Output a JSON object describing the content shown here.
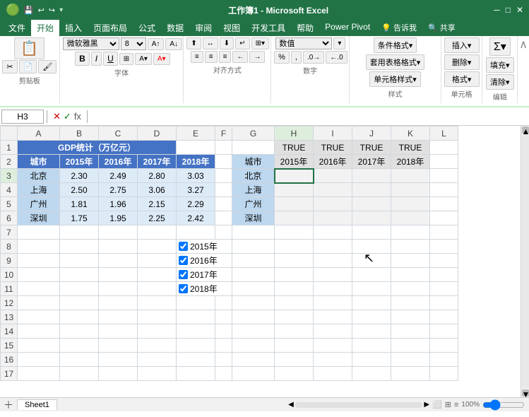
{
  "titleBar": {
    "title": "工作簿1 - Microsoft Excel",
    "minimize": "─",
    "maximize": "□",
    "close": "✕",
    "quickAccess": [
      "💾",
      "↩",
      "↪"
    ]
  },
  "ribbonTabs": [
    "文件",
    "开始",
    "插入",
    "页面布局",
    "公式",
    "数据",
    "审阅",
    "视图",
    "开发工具",
    "帮助",
    "Power Pivot",
    "💡 告诉我",
    "🔍 共享"
  ],
  "activeTab": "开始",
  "toolbar": {
    "clipboard": "剪贴板",
    "font": "字体",
    "alignment": "对齐方式",
    "number": "数字",
    "styles": "样式",
    "cells": "单元格",
    "editing": "编辑",
    "fontName": "微软雅黑",
    "fontSize": "8",
    "bold": "B",
    "italic": "I",
    "underline": "U",
    "conditionalFormat": "条件格式▾",
    "tableFormat": "套用表格格式▾",
    "cellStyle": "单元格样式▾",
    "insert": "单元格",
    "editBtn": "编辑"
  },
  "formulaBar": {
    "cellRef": "H3",
    "formula": ""
  },
  "columns": {
    "widths": [
      24,
      60,
      55,
      55,
      55,
      55,
      24,
      60,
      55,
      55,
      55,
      55,
      40
    ],
    "labels": [
      "",
      "A",
      "B",
      "C",
      "D",
      "E",
      "F",
      "G",
      "H",
      "I",
      "J",
      "K",
      "L"
    ]
  },
  "rows": [
    {
      "num": 1,
      "cells": [
        {
          "text": "",
          "class": ""
        },
        {
          "text": "GDP统计（万亿元）",
          "class": "data-cell-blue",
          "colspan": 4
        },
        {
          "text": "",
          "class": ""
        },
        {
          "text": "",
          "class": ""
        },
        {
          "text": "",
          "class": ""
        },
        {
          "text": "TRUE",
          "class": "true-cell"
        },
        {
          "text": "TRUE",
          "class": "true-cell"
        },
        {
          "text": "TRUE",
          "class": "true-cell"
        },
        {
          "text": "TRUE",
          "class": "true-cell"
        },
        {
          "text": "",
          "class": ""
        }
      ]
    },
    {
      "num": 2,
      "cells": [
        {
          "text": "",
          "class": ""
        },
        {
          "text": "城市",
          "class": "data-cell-header"
        },
        {
          "text": "2015年",
          "class": "data-cell-header"
        },
        {
          "text": "2016年",
          "class": "data-cell-header"
        },
        {
          "text": "2017年",
          "class": "data-cell-header"
        },
        {
          "text": "2018年",
          "class": "data-cell-header"
        },
        {
          "text": "",
          "class": ""
        },
        {
          "text": "城市",
          "class": "data-cell-city"
        },
        {
          "text": "2015年",
          "class": "data-cell-gray"
        },
        {
          "text": "2016年",
          "class": "data-cell-gray"
        },
        {
          "text": "2017年",
          "class": "data-cell-gray"
        },
        {
          "text": "2018年",
          "class": "data-cell-gray"
        },
        {
          "text": "",
          "class": ""
        }
      ]
    },
    {
      "num": 3,
      "cells": [
        {
          "text": "",
          "class": ""
        },
        {
          "text": "北京",
          "class": "data-cell-city"
        },
        {
          "text": "2.30",
          "class": "data-cell-value"
        },
        {
          "text": "2.49",
          "class": "data-cell-value"
        },
        {
          "text": "2.80",
          "class": "data-cell-value"
        },
        {
          "text": "3.03",
          "class": "data-cell-value"
        },
        {
          "text": "",
          "class": ""
        },
        {
          "text": "北京",
          "class": "data-cell-city"
        },
        {
          "text": "",
          "class": "data-cell-lightgray"
        },
        {
          "text": "",
          "class": "data-cell-lightgray"
        },
        {
          "text": "",
          "class": "data-cell-lightgray"
        },
        {
          "text": "",
          "class": "data-cell-lightgray"
        },
        {
          "text": "",
          "class": ""
        }
      ]
    },
    {
      "num": 4,
      "cells": [
        {
          "text": "",
          "class": ""
        },
        {
          "text": "上海",
          "class": "data-cell-city"
        },
        {
          "text": "2.50",
          "class": "data-cell-value"
        },
        {
          "text": "2.75",
          "class": "data-cell-value"
        },
        {
          "text": "3.06",
          "class": "data-cell-value"
        },
        {
          "text": "3.27",
          "class": "data-cell-value"
        },
        {
          "text": "",
          "class": ""
        },
        {
          "text": "上海",
          "class": "data-cell-city"
        },
        {
          "text": "",
          "class": "data-cell-lightgray"
        },
        {
          "text": "",
          "class": "data-cell-lightgray"
        },
        {
          "text": "",
          "class": "data-cell-lightgray"
        },
        {
          "text": "",
          "class": "data-cell-lightgray"
        },
        {
          "text": "",
          "class": ""
        }
      ]
    },
    {
      "num": 5,
      "cells": [
        {
          "text": "",
          "class": ""
        },
        {
          "text": "广州",
          "class": "data-cell-city"
        },
        {
          "text": "1.81",
          "class": "data-cell-value"
        },
        {
          "text": "1.96",
          "class": "data-cell-value"
        },
        {
          "text": "2.15",
          "class": "data-cell-value"
        },
        {
          "text": "2.29",
          "class": "data-cell-value"
        },
        {
          "text": "",
          "class": ""
        },
        {
          "text": "广州",
          "class": "data-cell-city"
        },
        {
          "text": "",
          "class": "data-cell-lightgray"
        },
        {
          "text": "",
          "class": "data-cell-lightgray"
        },
        {
          "text": "",
          "class": "data-cell-lightgray"
        },
        {
          "text": "",
          "class": "data-cell-lightgray"
        },
        {
          "text": "",
          "class": ""
        }
      ]
    },
    {
      "num": 6,
      "cells": [
        {
          "text": "",
          "class": ""
        },
        {
          "text": "深圳",
          "class": "data-cell-city"
        },
        {
          "text": "1.75",
          "class": "data-cell-value"
        },
        {
          "text": "1.95",
          "class": "data-cell-value"
        },
        {
          "text": "2.25",
          "class": "data-cell-value"
        },
        {
          "text": "2.42",
          "class": "data-cell-value"
        },
        {
          "text": "",
          "class": ""
        },
        {
          "text": "深圳",
          "class": "data-cell-city"
        },
        {
          "text": "",
          "class": "data-cell-lightgray"
        },
        {
          "text": "",
          "class": "data-cell-lightgray"
        },
        {
          "text": "",
          "class": "data-cell-lightgray"
        },
        {
          "text": "",
          "class": "data-cell-lightgray"
        },
        {
          "text": "",
          "class": ""
        }
      ]
    },
    {
      "num": 7,
      "cells": [
        {
          "text": "",
          "class": ""
        },
        {
          "text": "",
          "class": ""
        },
        {
          "text": "",
          "class": ""
        },
        {
          "text": "",
          "class": ""
        },
        {
          "text": "",
          "class": ""
        },
        {
          "text": "",
          "class": ""
        },
        {
          "text": "",
          "class": ""
        },
        {
          "text": "",
          "class": ""
        },
        {
          "text": "",
          "class": ""
        },
        {
          "text": "",
          "class": ""
        },
        {
          "text": "",
          "class": ""
        },
        {
          "text": "",
          "class": ""
        },
        {
          "text": "",
          "class": ""
        }
      ]
    },
    {
      "num": 8,
      "cells": [
        {
          "text": "",
          "class": ""
        },
        {
          "text": "",
          "class": ""
        },
        {
          "text": "",
          "class": ""
        },
        {
          "text": "",
          "class": ""
        },
        {
          "text": "",
          "class": ""
        },
        {
          "checkbox": true,
          "label": "2015年",
          "class": ""
        },
        {
          "text": "",
          "class": ""
        },
        {
          "text": "",
          "class": ""
        },
        {
          "text": "",
          "class": ""
        },
        {
          "text": "",
          "class": ""
        },
        {
          "text": "",
          "class": ""
        },
        {
          "text": "",
          "class": ""
        },
        {
          "text": "",
          "class": ""
        }
      ]
    },
    {
      "num": 9,
      "cells": [
        {
          "text": "",
          "class": ""
        },
        {
          "text": "",
          "class": ""
        },
        {
          "text": "",
          "class": ""
        },
        {
          "text": "",
          "class": ""
        },
        {
          "text": "",
          "class": ""
        },
        {
          "checkbox": true,
          "label": "2016年",
          "class": ""
        },
        {
          "text": "",
          "class": ""
        },
        {
          "text": "",
          "class": ""
        },
        {
          "text": "",
          "class": ""
        },
        {
          "text": "",
          "class": ""
        },
        {
          "text": "",
          "class": ""
        },
        {
          "text": "",
          "class": ""
        },
        {
          "text": "",
          "class": ""
        }
      ]
    },
    {
      "num": 10,
      "cells": [
        {
          "text": "",
          "class": ""
        },
        {
          "text": "",
          "class": ""
        },
        {
          "text": "",
          "class": ""
        },
        {
          "text": "",
          "class": ""
        },
        {
          "text": "",
          "class": ""
        },
        {
          "checkbox": true,
          "label": "2017年",
          "class": ""
        },
        {
          "text": "",
          "class": ""
        },
        {
          "text": "",
          "class": ""
        },
        {
          "text": "",
          "class": ""
        },
        {
          "text": "",
          "class": ""
        },
        {
          "text": "",
          "class": ""
        },
        {
          "text": "",
          "class": ""
        },
        {
          "text": "",
          "class": ""
        }
      ]
    },
    {
      "num": 11,
      "cells": [
        {
          "text": "",
          "class": ""
        },
        {
          "text": "",
          "class": ""
        },
        {
          "text": "",
          "class": ""
        },
        {
          "text": "",
          "class": ""
        },
        {
          "text": "",
          "class": ""
        },
        {
          "checkbox": true,
          "label": "2018年",
          "class": ""
        },
        {
          "text": "",
          "class": ""
        },
        {
          "text": "",
          "class": ""
        },
        {
          "text": "",
          "class": ""
        },
        {
          "text": "",
          "class": ""
        },
        {
          "text": "",
          "class": ""
        },
        {
          "text": "",
          "class": ""
        },
        {
          "text": "",
          "class": ""
        }
      ]
    },
    {
      "num": 12,
      "cells": [
        {
          "text": "",
          "class": ""
        },
        {
          "text": "",
          "class": ""
        },
        {
          "text": "",
          "class": ""
        },
        {
          "text": "",
          "class": ""
        },
        {
          "text": "",
          "class": ""
        },
        {
          "text": "",
          "class": ""
        },
        {
          "text": "",
          "class": ""
        },
        {
          "text": "",
          "class": ""
        },
        {
          "text": "",
          "class": ""
        },
        {
          "text": "",
          "class": ""
        },
        {
          "text": "",
          "class": ""
        },
        {
          "text": "",
          "class": ""
        },
        {
          "text": "",
          "class": ""
        }
      ]
    },
    {
      "num": 13,
      "cells": [
        {
          "text": "",
          "class": ""
        },
        {
          "text": "",
          "class": ""
        },
        {
          "text": "",
          "class": ""
        },
        {
          "text": "",
          "class": ""
        },
        {
          "text": "",
          "class": ""
        },
        {
          "text": "",
          "class": ""
        },
        {
          "text": "",
          "class": ""
        },
        {
          "text": "",
          "class": ""
        },
        {
          "text": "",
          "class": ""
        },
        {
          "text": "",
          "class": ""
        },
        {
          "text": "",
          "class": ""
        },
        {
          "text": "",
          "class": ""
        },
        {
          "text": "",
          "class": ""
        }
      ]
    },
    {
      "num": 14,
      "cells": [
        {
          "text": "",
          "class": ""
        },
        {
          "text": "",
          "class": ""
        },
        {
          "text": "",
          "class": ""
        },
        {
          "text": "",
          "class": ""
        },
        {
          "text": "",
          "class": ""
        },
        {
          "text": "",
          "class": ""
        },
        {
          "text": "",
          "class": ""
        },
        {
          "text": "",
          "class": ""
        },
        {
          "text": "",
          "class": ""
        },
        {
          "text": "",
          "class": ""
        },
        {
          "text": "",
          "class": ""
        },
        {
          "text": "",
          "class": ""
        },
        {
          "text": "",
          "class": ""
        }
      ]
    },
    {
      "num": 15,
      "cells": [
        {
          "text": "",
          "class": ""
        },
        {
          "text": "",
          "class": ""
        },
        {
          "text": "",
          "class": ""
        },
        {
          "text": "",
          "class": ""
        },
        {
          "text": "",
          "class": ""
        },
        {
          "text": "",
          "class": ""
        },
        {
          "text": "",
          "class": ""
        },
        {
          "text": "",
          "class": ""
        },
        {
          "text": "",
          "class": ""
        },
        {
          "text": "",
          "class": ""
        },
        {
          "text": "",
          "class": ""
        },
        {
          "text": "",
          "class": ""
        },
        {
          "text": "",
          "class": ""
        }
      ]
    },
    {
      "num": 16,
      "cells": [
        {
          "text": "",
          "class": ""
        },
        {
          "text": "",
          "class": ""
        },
        {
          "text": "",
          "class": ""
        },
        {
          "text": "",
          "class": ""
        },
        {
          "text": "",
          "class": ""
        },
        {
          "text": "",
          "class": ""
        },
        {
          "text": "",
          "class": ""
        },
        {
          "text": "",
          "class": ""
        },
        {
          "text": "",
          "class": ""
        },
        {
          "text": "",
          "class": ""
        },
        {
          "text": "",
          "class": ""
        },
        {
          "text": "",
          "class": ""
        },
        {
          "text": "",
          "class": ""
        }
      ]
    },
    {
      "num": 17,
      "cells": [
        {
          "text": "",
          "class": ""
        },
        {
          "text": "",
          "class": ""
        },
        {
          "text": "",
          "class": ""
        },
        {
          "text": "",
          "class": ""
        },
        {
          "text": "",
          "class": ""
        },
        {
          "text": "",
          "class": ""
        },
        {
          "text": "",
          "class": ""
        },
        {
          "text": "",
          "class": ""
        },
        {
          "text": "",
          "class": ""
        },
        {
          "text": "",
          "class": ""
        },
        {
          "text": "",
          "class": ""
        },
        {
          "text": "",
          "class": ""
        },
        {
          "text": "",
          "class": ""
        }
      ]
    }
  ],
  "colLabels": [
    "",
    "A",
    "B",
    "C",
    "D",
    "E",
    "F",
    "G",
    "H",
    "I",
    "J",
    "K",
    "L"
  ],
  "checkboxes": {
    "2015": "2015年",
    "2016": "2016年",
    "2017": "2017年",
    "2018": "2018年"
  }
}
